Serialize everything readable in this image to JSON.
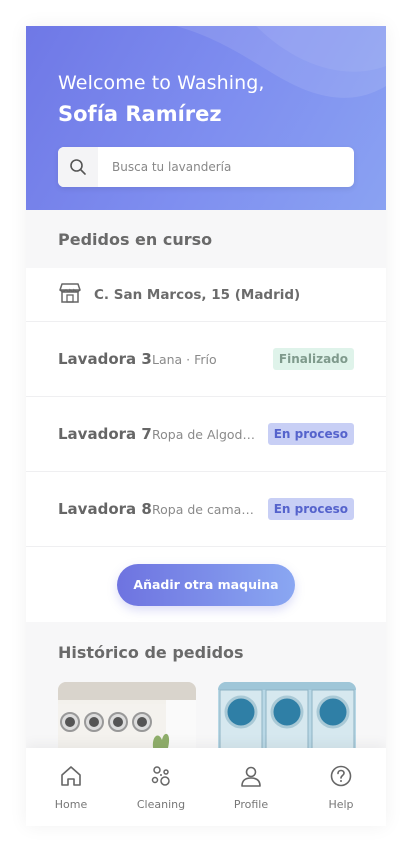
{
  "header": {
    "greeting": "Welcome to Washing,",
    "user_name": "Sofía Ramírez",
    "search_placeholder": "Busca tu lavandería",
    "gradient_start": "#6f78e6",
    "gradient_end": "#8aa2f2"
  },
  "current_orders": {
    "title": "Pedidos en curso",
    "address": "C. San Marcos, 15 (Madrid)",
    "orders": [
      {
        "machine": "Lavadora 3",
        "description": "Lana · Frío",
        "status": "Finalizado"
      },
      {
        "machine": "Lavadora 7",
        "description": "Ropa de Algodón · Templado",
        "status": "En proceso"
      },
      {
        "machine": "Lavadora 8",
        "description": "Ropa de cama · Caliente",
        "status": "En proceso"
      }
    ],
    "add_button": "Añadir otra maquina"
  },
  "history": {
    "title": "Histórico de pedidos"
  },
  "nav": {
    "items": [
      {
        "label": "Home",
        "icon": "home-icon"
      },
      {
        "label": "Cleaning",
        "icon": "bubbles-icon"
      },
      {
        "label": "Profile",
        "icon": "user-icon"
      },
      {
        "label": "Help",
        "icon": "help-icon"
      }
    ]
  },
  "colors": {
    "accent": "#6e73e0",
    "status_done_bg": "#dff3ea",
    "status_progress_bg": "#c8cff5"
  }
}
